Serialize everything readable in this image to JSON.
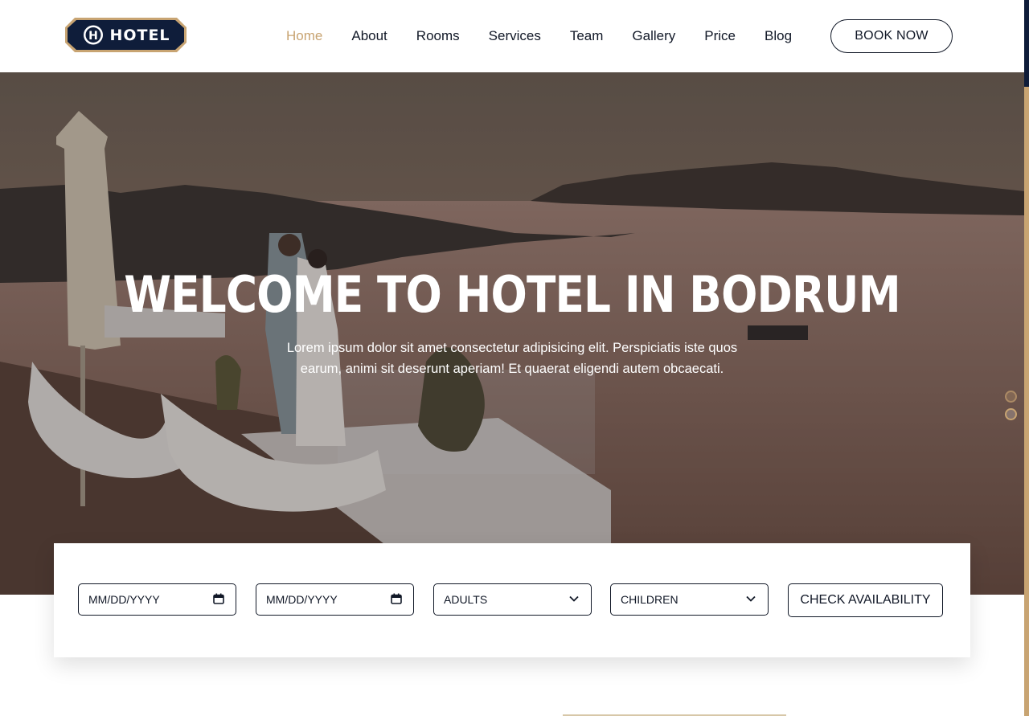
{
  "logo": {
    "text": "HOTEL",
    "mark": "H"
  },
  "nav": {
    "items": [
      {
        "label": "Home",
        "active": true
      },
      {
        "label": "About"
      },
      {
        "label": "Rooms"
      },
      {
        "label": "Services"
      },
      {
        "label": "Team"
      },
      {
        "label": "Gallery"
      },
      {
        "label": "Price"
      },
      {
        "label": "Blog"
      }
    ],
    "book_label": "BOOK NOW"
  },
  "hero": {
    "title": "WELCOME TO HOTEL IN BODRUM",
    "subtitle": "Lorem ipsum dolor sit amet consectetur adipisicing elit. Perspiciatis iste quos earum, animi sit deserunt aperiam! Et quaerat eligendi autem obcaecati.",
    "slider": {
      "slides": 2,
      "active_index": 1
    }
  },
  "booking": {
    "checkin_placeholder": "MM/DD/YYYY",
    "checkout_placeholder": "MM/DD/YYYY",
    "adults_label": "ADULTS",
    "children_label": "CHILDREN",
    "check_label": "CHECK AVAILABILITY"
  },
  "colors": {
    "accent": "#c8a472",
    "navy": "#0f1d3a",
    "text": "#111827"
  },
  "icons": {
    "calendar": "calendar-icon",
    "chevron": "chevron-down-icon"
  }
}
